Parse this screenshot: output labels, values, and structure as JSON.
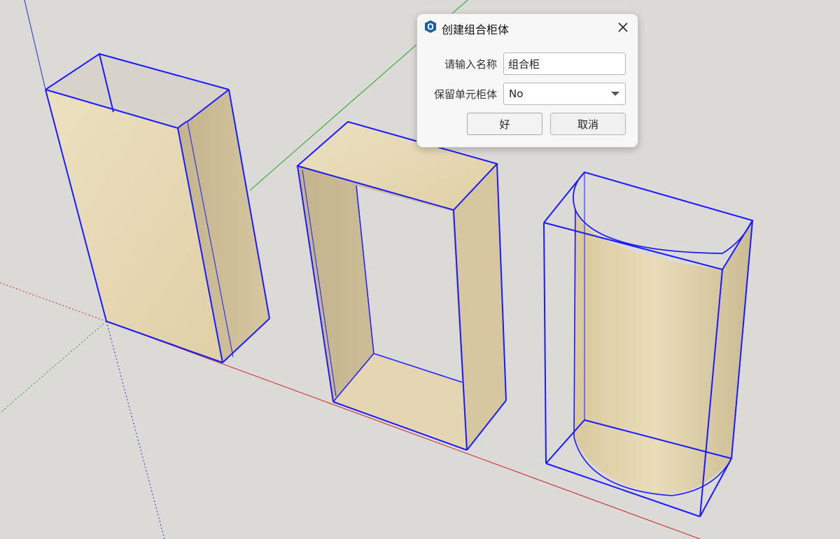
{
  "dialog": {
    "title": "创建组合柜体",
    "icon": "sketchup-logo-icon",
    "name_label": "请输入名称",
    "name_value": "组合柜",
    "keep_label": "保留单元柜体",
    "keep_value": "No",
    "ok_label": "好",
    "cancel_label": "取消"
  },
  "colors": {
    "background": "#dcdad6",
    "edge_highlight": "#1a1aff",
    "wood": "#e2d3ad",
    "axis_red": "#cc2222",
    "axis_green": "#22aa22",
    "axis_blue": "#2233cc"
  }
}
